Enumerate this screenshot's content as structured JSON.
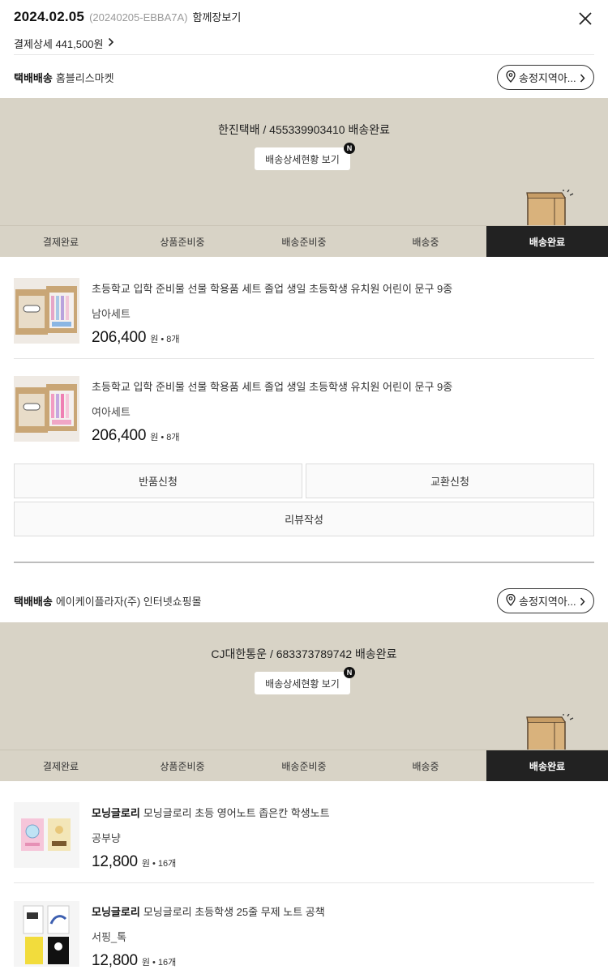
{
  "header": {
    "date": "2024.02.05",
    "order_code": "(20240205-EBBA7A)",
    "together_label": "함께장보기",
    "payment_detail_label": "결제상세 441,500원"
  },
  "steps_labels": [
    "결제완료",
    "상품준비중",
    "배송준비중",
    "배송중",
    "배송완료"
  ],
  "shipments": [
    {
      "ship_type": "택배배송",
      "seller": "홈블리스마켓",
      "region_label": "송정지역아...",
      "carrier_info": "한진택배 / 455339903410 배송완료",
      "detail_label": "배송상세현황 보기",
      "badge": "N",
      "active_step": "배송완료",
      "items": [
        {
          "brand": "",
          "title": "초등학교 입학 준비물 선물 학용품 세트 졸업 생일 초등학생 유치원 어린이 문구 9종",
          "option": "남아세트",
          "price": "206,400",
          "won": "원",
          "qty": "8개"
        },
        {
          "brand": "",
          "title": "초등학교 입학 준비물 선물 학용품 세트 졸업 생일 초등학생 유치원 어린이 문구 9종",
          "option": "여아세트",
          "price": "206,400",
          "won": "원",
          "qty": "8개"
        }
      ],
      "actions": {
        "return_label": "반품신청",
        "exchange_label": "교환신청",
        "review_label": "리뷰작성"
      }
    },
    {
      "ship_type": "택배배송",
      "seller": "에이케이플라자(주) 인터넷쇼핑몰",
      "region_label": "송정지역아...",
      "carrier_info": "CJ대한통운 / 683373789742 배송완료",
      "detail_label": "배송상세현황 보기",
      "badge": "N",
      "active_step": "배송완료",
      "items": [
        {
          "brand": "모닝글로리",
          "title": "모닝글로리 초등 영어노트 좁은칸 학생노트",
          "option": "공부냥",
          "price": "12,800",
          "won": "원",
          "qty": "16개"
        },
        {
          "brand": "모닝글로리",
          "title": "모닝글로리 초등학생 25줄 무제 노트 공책",
          "option": "서핑_톡",
          "price": "12,800",
          "won": "원",
          "qty": "16개"
        }
      ]
    }
  ],
  "colors": {
    "panel_bg": "#d8d3c6",
    "active_step_bg": "#222222",
    "box_color": "#d9b27c"
  }
}
